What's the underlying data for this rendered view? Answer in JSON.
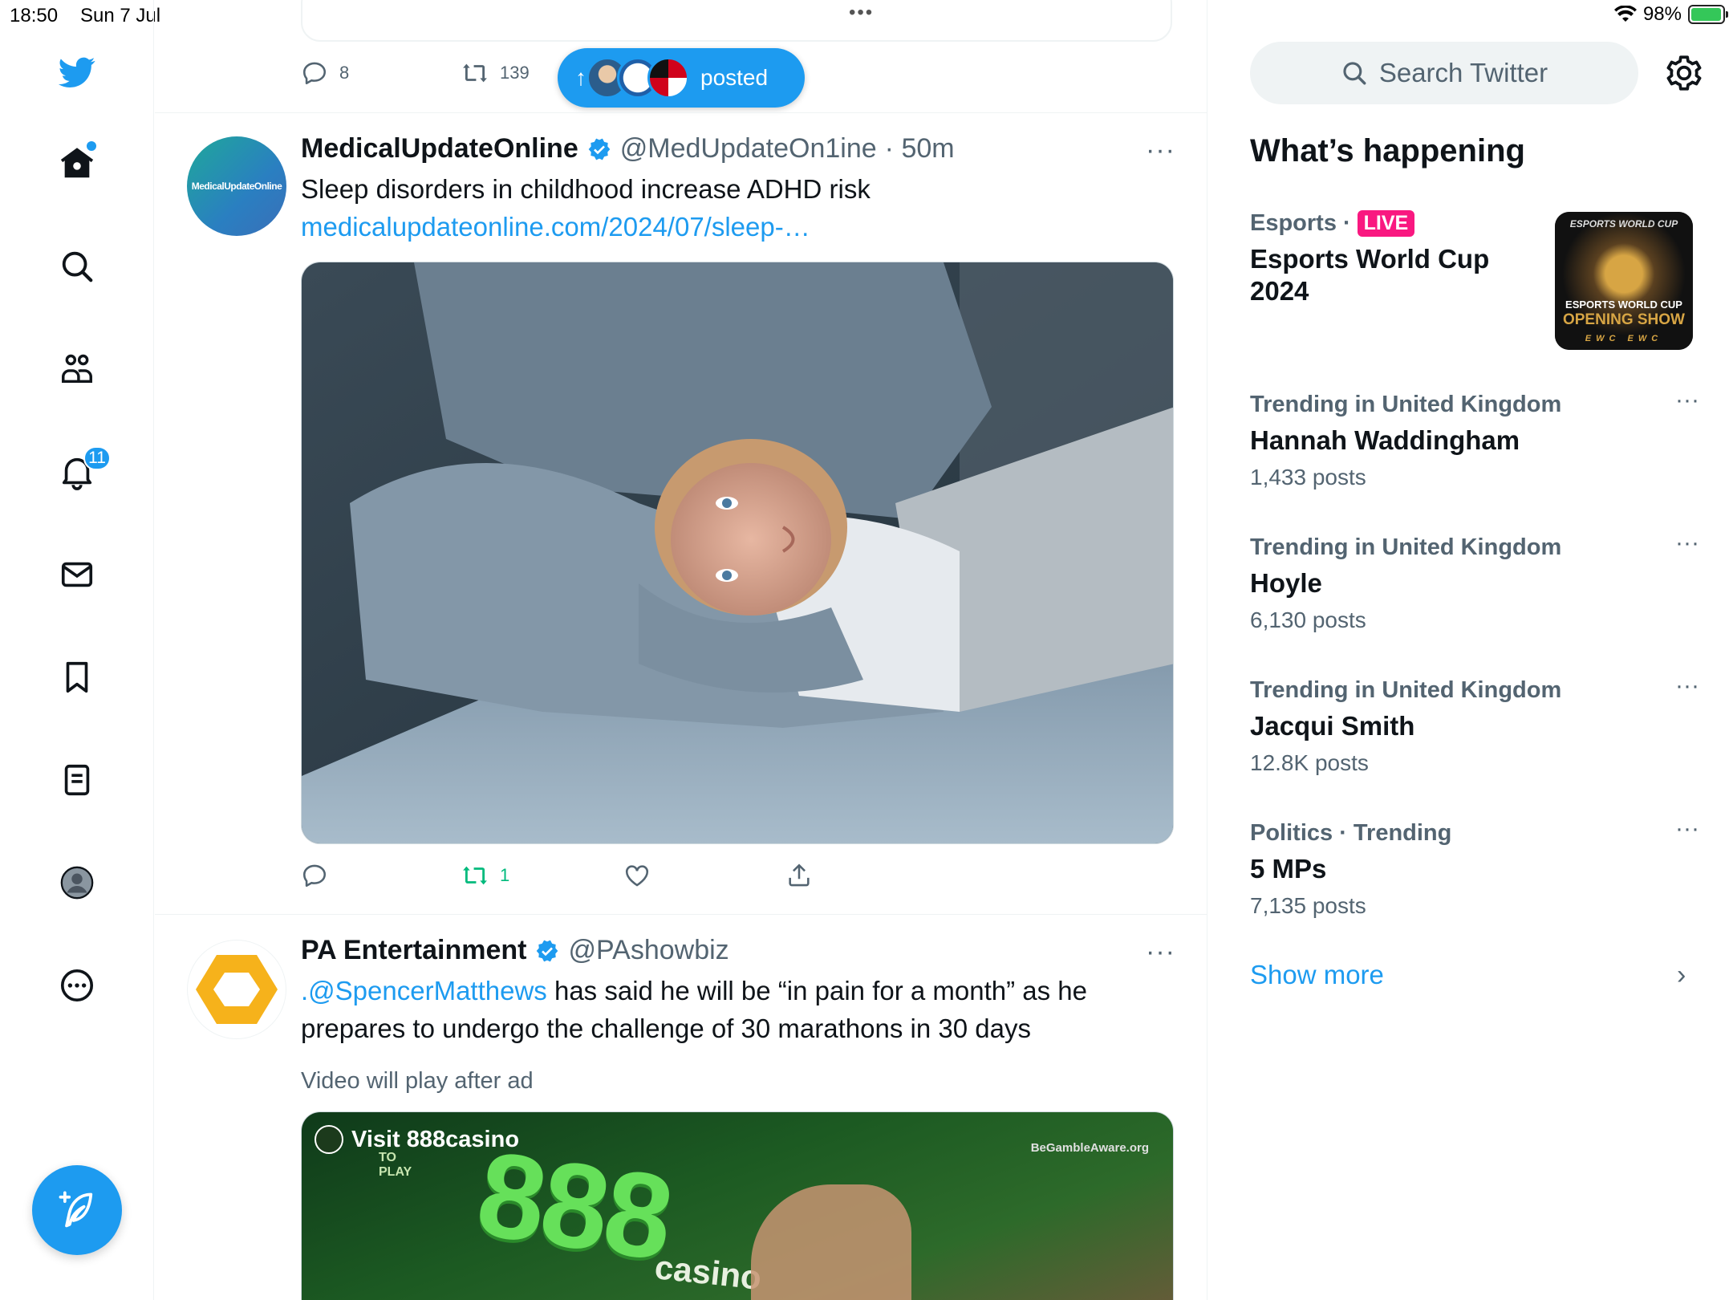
{
  "status_bar": {
    "time": "18:50",
    "date": "Sun 7 Jul",
    "battery": "98%",
    "battery_level": 0.98
  },
  "nav": {
    "notifications_count": "11"
  },
  "feed": {
    "prev_tweet": {
      "reply_count": "8",
      "retweet_count": "139"
    },
    "new_posts_pill": {
      "label": "posted"
    },
    "tweets": [
      {
        "name": "MedicalUpdateOnline",
        "handle": "@MedUpdateOn1ine",
        "time": "· 50m",
        "text": "Sleep disorders in childhood increase ADHD risk",
        "link": "medicalupdateonline.com/2024/07/sleep-…",
        "avatar_text": "MedicalUpdateOnline",
        "retweet_count": "1",
        "more": "···"
      },
      {
        "name": "PA Entertainment",
        "handle": "@PAshowbiz",
        "mention": ".@SpencerMatthews",
        "text": " has said he will be “in pain for a month” as he prepares to undergo the challenge of 30 marathons in 30 days",
        "video_note": "Video will play after ad",
        "ad_label": "Visit 888casino",
        "ad_brand": "888",
        "ad_sub": "casino",
        "ad_gamble": "BeGambleAware.org",
        "ad_corner_top": "TO",
        "ad_corner_bottom": "PLAY",
        "more": "···"
      }
    ]
  },
  "sidebar": {
    "search_placeholder": "Search Twitter",
    "section_title": "What’s happening",
    "featured": {
      "category": "Esports",
      "sep": "·",
      "live": "LIVE",
      "title": "Esports World Cup 2024",
      "thumb_top": "ESPORTS WORLD CUP",
      "thumb_line1": "ESPORTS WORLD CUP",
      "thumb_line2": "OPENING SHOW",
      "thumb_footer": "EWC EWC"
    },
    "trends": [
      {
        "meta": "Trending in United Kingdom",
        "title": "Hannah Waddingham",
        "count": "1,433 posts"
      },
      {
        "meta": "Trending in United Kingdom",
        "title": "Hoyle",
        "count": "6,130 posts"
      },
      {
        "meta": "Trending in United Kingdom",
        "title": "Jacqui Smith",
        "count": "12.8K posts"
      },
      {
        "meta": "Politics · Trending",
        "title": "5 MPs",
        "count": "7,135 posts"
      }
    ],
    "trend_more": "···",
    "show_more": "Show more"
  },
  "colors": {
    "accent": "#1d9bf0",
    "text": "#0f1419",
    "muted": "#536471",
    "retweet_green": "#00ba7c",
    "live_pink": "#f91880"
  },
  "icons": {
    "nav": [
      "twitter-logo-icon",
      "home-icon",
      "search-icon",
      "communities-icon",
      "bell-icon",
      "mail-icon",
      "bookmark-icon",
      "lists-icon",
      "profile-icon",
      "more-circle-icon",
      "compose-icon"
    ]
  }
}
